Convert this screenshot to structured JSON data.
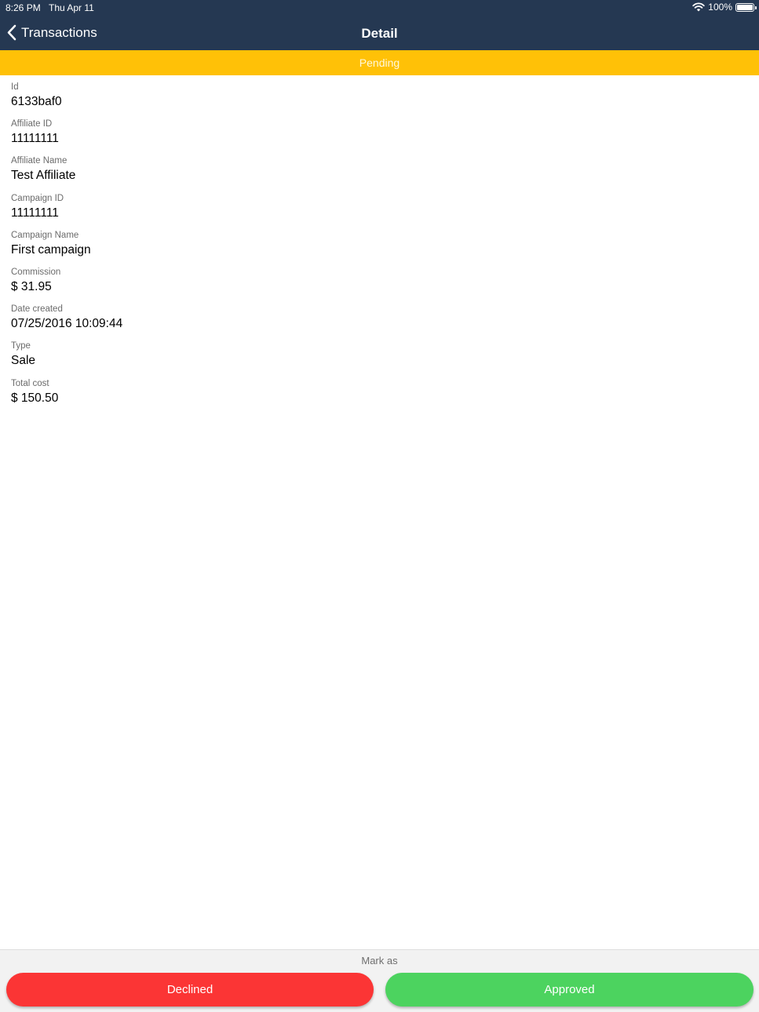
{
  "status_bar": {
    "time": "8:26 PM",
    "date": "Thu Apr 11",
    "battery": "100%"
  },
  "nav": {
    "back_label": "Transactions",
    "title": "Detail"
  },
  "status_banner": {
    "label": "Pending"
  },
  "fields": [
    {
      "label": "Id",
      "value": "6133baf0"
    },
    {
      "label": "Affiliate ID",
      "value": "11111111"
    },
    {
      "label": "Affiliate Name",
      "value": "Test Affiliate"
    },
    {
      "label": "Campaign ID",
      "value": "11111111"
    },
    {
      "label": "Campaign Name",
      "value": "First campaign"
    },
    {
      "label": "Commission",
      "value": "$ 31.95"
    },
    {
      "label": "Date created",
      "value": "07/25/2016 10:09:44"
    },
    {
      "label": "Type",
      "value": "Sale"
    },
    {
      "label": "Total cost",
      "value": "$ 150.50"
    }
  ],
  "footer": {
    "mark_as": "Mark as",
    "declined_label": "Declined",
    "approved_label": "Approved"
  },
  "colors": {
    "nav_bg": "#253852",
    "pending": "#ffc107",
    "declined": "#fb3535",
    "approved": "#4cd35f"
  }
}
